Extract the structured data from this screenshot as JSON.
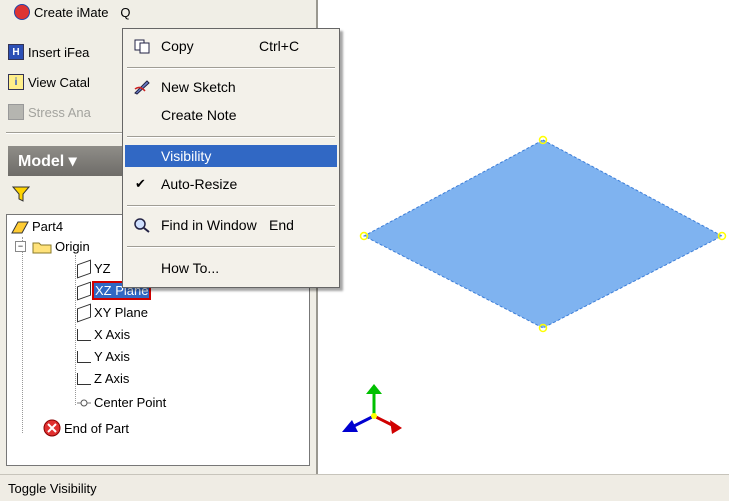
{
  "toolbar": {
    "create_imate": "Create iMate",
    "create_imate_shortcut": "Q",
    "insert_ifeature": "Insert iFea",
    "view_catalog": "View Catal",
    "stress_analysis": "Stress Ana"
  },
  "browser": {
    "model_label": "Model",
    "model_arrow": "▾",
    "filter_icon": "filter-icon"
  },
  "tree": {
    "part": "Part4",
    "origin": "Origin",
    "items": [
      "YZ",
      "XZ Plane",
      "XY Plane",
      "X Axis",
      "Y Axis",
      "Z Axis",
      "Center Point"
    ],
    "end_of_part": "End of Part"
  },
  "context_menu": {
    "copy": "Copy",
    "copy_shortcut": "Ctrl+C",
    "new_sketch": "New Sketch",
    "create_note": "Create Note",
    "visibility": "Visibility",
    "auto_resize": "Auto-Resize",
    "auto_resize_checked": "✔",
    "find_in_window": "Find in Window",
    "find_in_window_shortcut": "End",
    "how_to": "How To..."
  },
  "status": {
    "text": "Toggle Visibility"
  },
  "colors": {
    "plane_fill": "#7fb3f0",
    "plane_edge": "#3b7dd8",
    "vertex": "#ffff00",
    "menu_highlight": "#3168c4",
    "selection_outline": "#d00000",
    "triad_x": "#d00000",
    "triad_y": "#00c000",
    "triad_z": "#0000d0"
  }
}
